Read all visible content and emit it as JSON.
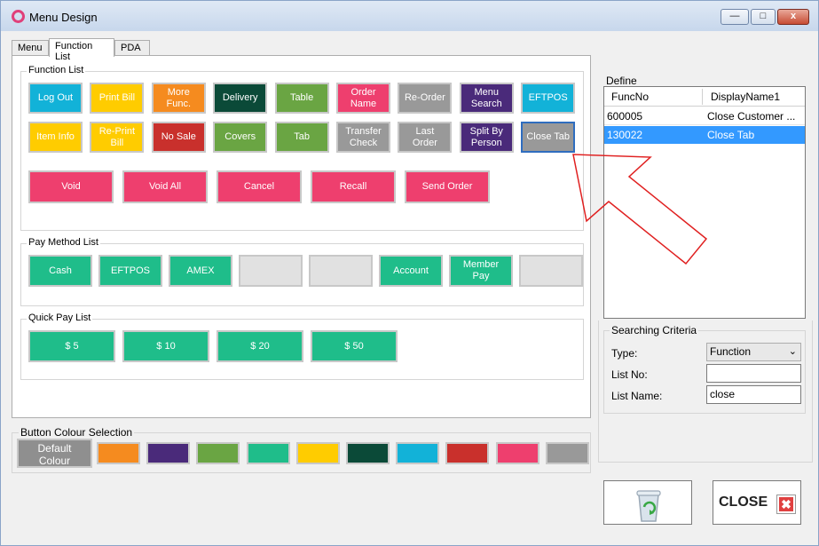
{
  "window": {
    "title": "Menu Design",
    "minimize": "—",
    "maximize": "□",
    "close": "x"
  },
  "tabs": [
    "Menu",
    "Function List",
    "PDA"
  ],
  "function_list": {
    "title": "Function List",
    "row1": [
      {
        "label": "Log Out",
        "color": "#12b2d8"
      },
      {
        "label": "Print Bill",
        "color": "#ffcc00"
      },
      {
        "label": "More\nFunc.",
        "color": "#f58b1f"
      },
      {
        "label": "Delivery",
        "color": "#0b4a38"
      },
      {
        "label": "Table",
        "color": "#6aa543"
      },
      {
        "label": "Order\nName",
        "color": "#ee3f6e"
      },
      {
        "label": "Re-Order",
        "color": "#999999"
      },
      {
        "label": "Menu\nSearch",
        "color": "#4a2a7a"
      },
      {
        "label": "EFTPOS",
        "color": "#12b2d8"
      }
    ],
    "row2": [
      {
        "label": "Item Info",
        "color": "#ffcc00"
      },
      {
        "label": "Re-Print\nBill",
        "color": "#ffcc00"
      },
      {
        "label": "No Sale",
        "color": "#c9302c"
      },
      {
        "label": "Covers",
        "color": "#6aa543"
      },
      {
        "label": "Tab",
        "color": "#6aa543"
      },
      {
        "label": "Transfer\nCheck",
        "color": "#999999"
      },
      {
        "label": "Last\nOrder",
        "color": "#999999"
      },
      {
        "label": "Split By\nPerson",
        "color": "#4a2a7a"
      },
      {
        "label": "Close Tab",
        "color": "#999999"
      }
    ],
    "row3": [
      {
        "label": "Void",
        "color": "#ee3f6e"
      },
      {
        "label": "Void All",
        "color": "#ee3f6e"
      },
      {
        "label": "Cancel",
        "color": "#ee3f6e"
      },
      {
        "label": "Recall",
        "color": "#ee3f6e"
      },
      {
        "label": "Send Order",
        "color": "#ee3f6e"
      }
    ]
  },
  "pay_method_list": {
    "title": "Pay Method List",
    "buttons": [
      {
        "label": "Cash",
        "color": "#1fbd8a"
      },
      {
        "label": "EFTPOS",
        "color": "#1fbd8a"
      },
      {
        "label": "AMEX",
        "color": "#1fbd8a"
      },
      {
        "label": "",
        "color": "#e1e1e1"
      },
      {
        "label": "",
        "color": "#e1e1e1"
      },
      {
        "label": "Account",
        "color": "#1fbd8a"
      },
      {
        "label": "Member\nPay",
        "color": "#1fbd8a"
      },
      {
        "label": "",
        "color": "#e1e1e1"
      }
    ]
  },
  "quick_pay_list": {
    "title": "Quick Pay List",
    "buttons": [
      {
        "label": "$ 5",
        "color": "#1fbd8a"
      },
      {
        "label": "$ 10",
        "color": "#1fbd8a"
      },
      {
        "label": "$ 20",
        "color": "#1fbd8a"
      },
      {
        "label": "$ 50",
        "color": "#1fbd8a"
      }
    ]
  },
  "button_colour_selection": {
    "title": "Button Colour Selection",
    "default_label": "Default\nColour",
    "swatches": [
      "#f58b1f",
      "#4a2a7a",
      "#6aa543",
      "#1fbd8a",
      "#ffcc00",
      "#0b4a38",
      "#12b2d8",
      "#c9302c",
      "#ee3f6e",
      "#999999"
    ]
  },
  "define": {
    "title": "Define",
    "columns": [
      "FuncNo",
      "DisplayName1"
    ],
    "rows": [
      {
        "func_no": "600005",
        "display_name": "Close Customer ..."
      },
      {
        "func_no": "130022",
        "display_name": "Close Tab",
        "selected": true
      }
    ]
  },
  "searching_criteria": {
    "title": "Searching Criteria",
    "type_label": "Type:",
    "type_value": "Function",
    "list_no_label": "List No:",
    "list_no_value": "",
    "list_name_label": "List Name:",
    "list_name_value": "close"
  },
  "actions": {
    "close_label": "CLOSE"
  },
  "icons": {
    "app": "app-ring-icon",
    "recycle": "recycle-bin-icon",
    "close": "close-x-icon",
    "arrow": "arrow-annotation"
  },
  "selected_button": "Close Tab"
}
